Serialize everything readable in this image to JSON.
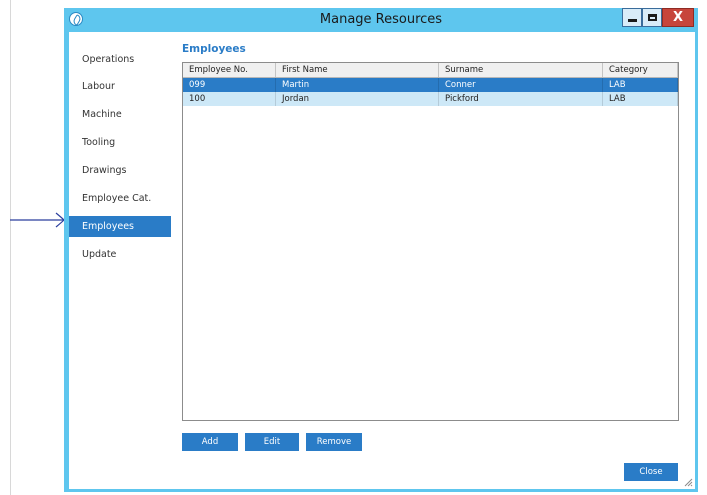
{
  "window": {
    "title": "Manage Resources",
    "close_glyph": "X"
  },
  "sidebar": {
    "active_index": 6,
    "items": [
      {
        "label": "Operations"
      },
      {
        "label": "Labour"
      },
      {
        "label": "Machine"
      },
      {
        "label": "Tooling"
      },
      {
        "label": "Drawings"
      },
      {
        "label": "Employee Cat."
      },
      {
        "label": "Employees"
      },
      {
        "label": "Update"
      }
    ]
  },
  "main": {
    "section_title": "Employees",
    "table": {
      "columns": [
        "Employee No.",
        "First Name",
        "Surname",
        "Category"
      ],
      "rows": [
        {
          "employee_no": "099",
          "first_name": "Martin",
          "surname": "Conner",
          "category": "LAB",
          "selected": true
        },
        {
          "employee_no": "100",
          "first_name": "Jordan",
          "surname": "Pickford",
          "category": "LAB",
          "selected": false
        }
      ]
    },
    "buttons": {
      "add": "Add",
      "edit": "Edit",
      "remove": "Remove",
      "close": "Close"
    }
  },
  "colors": {
    "accent": "#2a7cc7",
    "titlebar": "#5ec6ee",
    "row_alt": "#cde8f7",
    "close_button": "#c7453b"
  },
  "annotations": {
    "arrow_icon": "arrow-right-icon"
  }
}
